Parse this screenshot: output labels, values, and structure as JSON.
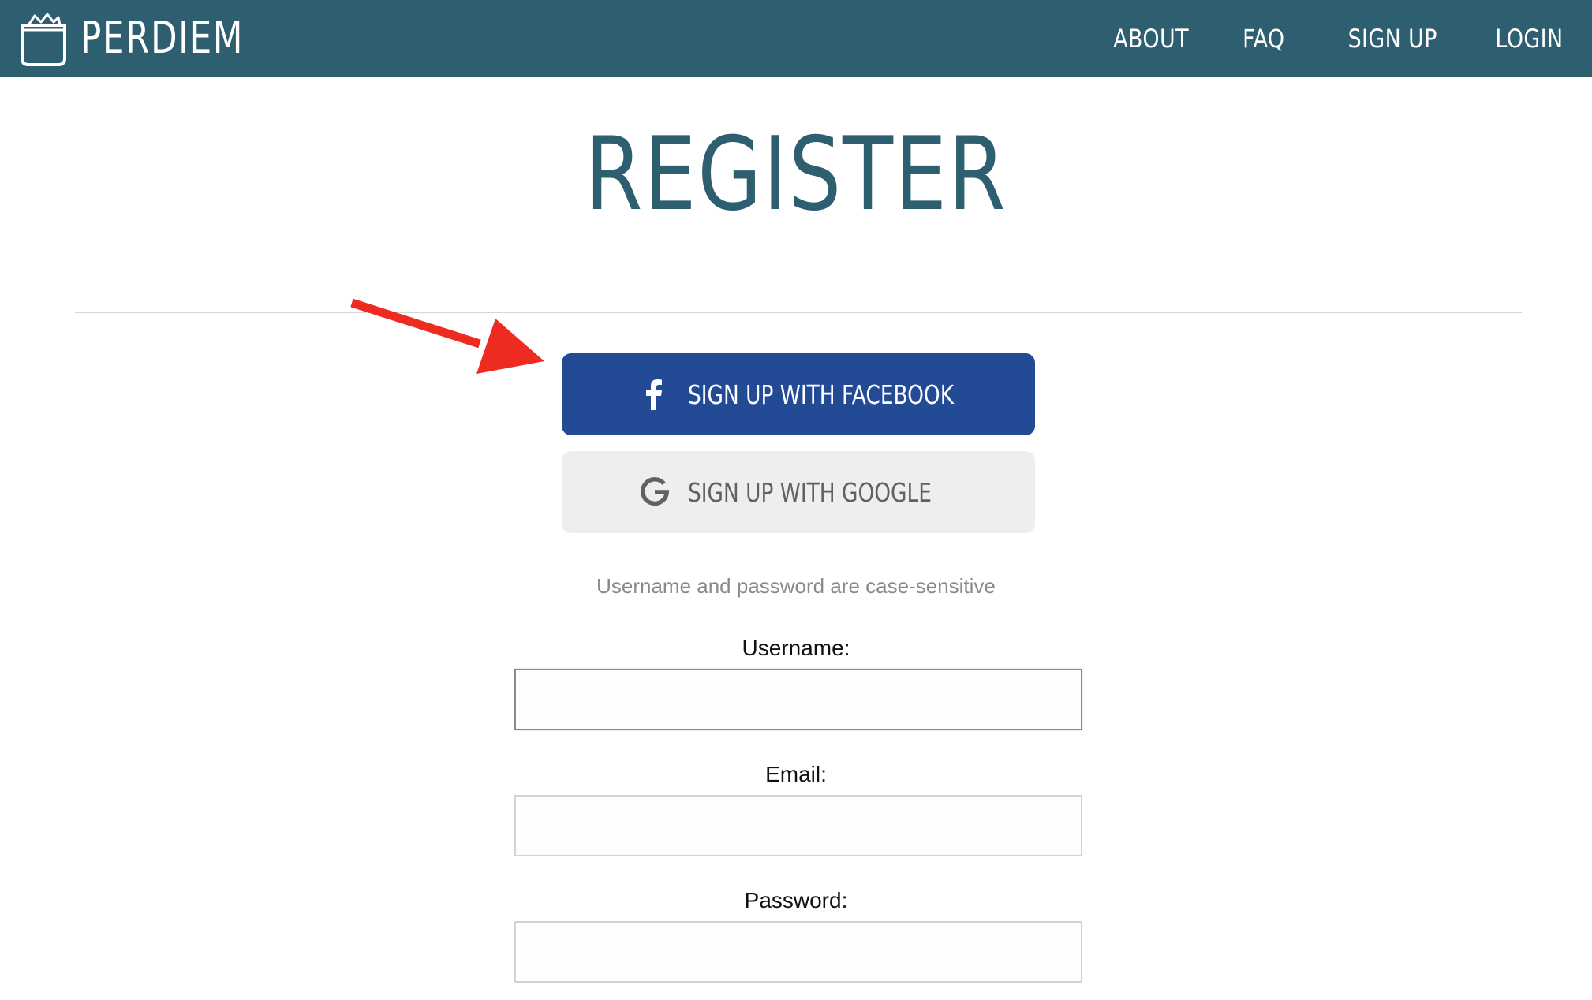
{
  "colors": {
    "header_bg": "#2e5f70",
    "title": "#2e5f70",
    "facebook": "#234a95",
    "google_bg": "#eeeeee",
    "arrow": "#ee2b20"
  },
  "header": {
    "brand": "PERDIEM",
    "nav": [
      {
        "label": "ABOUT"
      },
      {
        "label": "FAQ"
      },
      {
        "label": "SIGN UP"
      },
      {
        "label": "LOGIN"
      }
    ]
  },
  "page": {
    "title": "REGISTER"
  },
  "social": {
    "facebook_label": "SIGN UP WITH FACEBOOK",
    "facebook_icon": "facebook-icon",
    "google_label": "SIGN UP WITH GOOGLE",
    "google_icon": "google-icon"
  },
  "hint": "Username and password are case-sensitive",
  "form": {
    "username_label": "Username:",
    "username_value": "",
    "email_label": "Email:",
    "email_value": "",
    "password_label": "Password:",
    "password_value": ""
  }
}
